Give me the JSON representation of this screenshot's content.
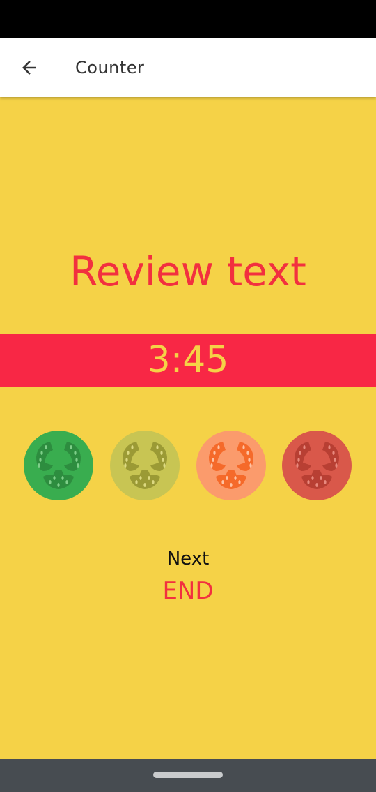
{
  "app_bar": {
    "title": "Counter",
    "back_icon": "arrow-left-icon"
  },
  "session": {
    "phase_title": "Review text",
    "timer": "3:45",
    "next_label": "Next",
    "next_value": "END"
  },
  "tomatoes": [
    {
      "name": "tomato-green-icon",
      "skin": "#39ad4f",
      "flesh": "#2d8d3f",
      "seed": "#7fcf8a"
    },
    {
      "name": "tomato-olive-icon",
      "skin": "#c8c553",
      "flesh": "#9b9a35",
      "seed": "#dcd981"
    },
    {
      "name": "tomato-orange-icon",
      "skin": "#fb9b6c",
      "flesh": "#f56a2a",
      "seed": "#ffc3a3"
    },
    {
      "name": "tomato-red-icon",
      "skin": "#d9584a",
      "flesh": "#b83f33",
      "seed": "#e8897e"
    }
  ],
  "colors": {
    "background": "#f5d247",
    "accent": "#f2303f",
    "timer_band": "#f82745",
    "nav_bar": "#474c51"
  }
}
